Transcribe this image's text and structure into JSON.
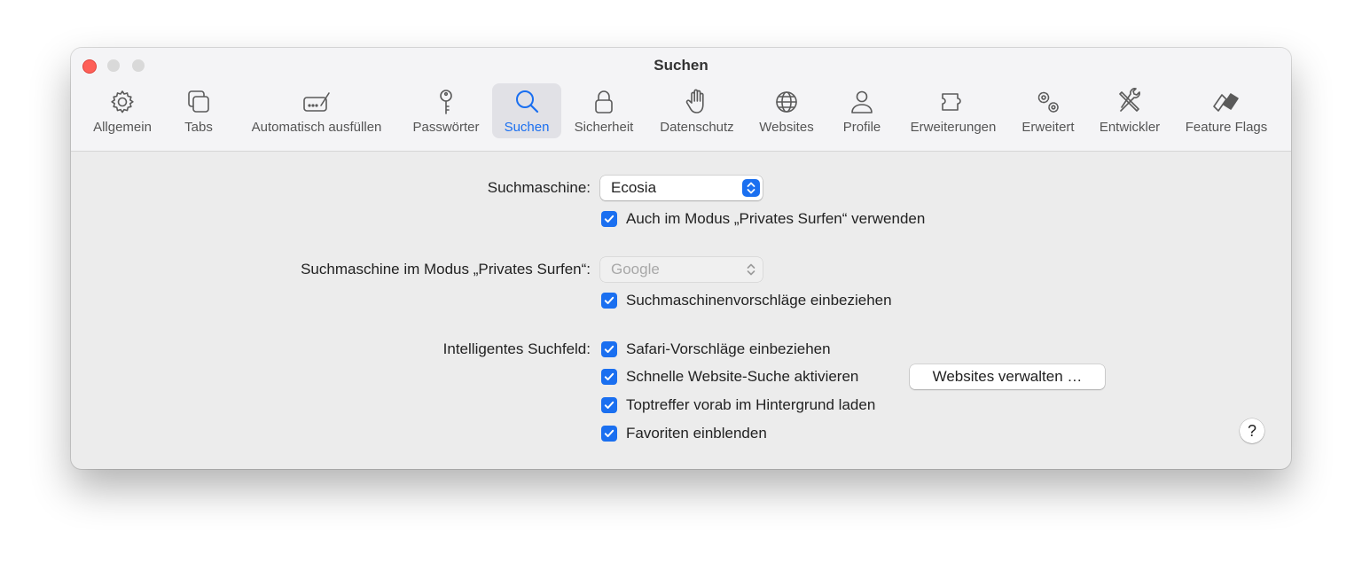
{
  "window": {
    "title": "Suchen"
  },
  "toolbar": {
    "tabs": [
      {
        "label": "Allgemein",
        "icon": "gear-icon"
      },
      {
        "label": "Tabs",
        "icon": "tabs-icon"
      },
      {
        "label": "Automatisch ausfüllen",
        "icon": "autofill-icon"
      },
      {
        "label": "Passwörter",
        "icon": "key-icon"
      },
      {
        "label": "Suchen",
        "icon": "search-icon",
        "active": true
      },
      {
        "label": "Sicherheit",
        "icon": "lock-icon"
      },
      {
        "label": "Datenschutz",
        "icon": "hand-icon"
      },
      {
        "label": "Websites",
        "icon": "globe-icon"
      },
      {
        "label": "Profile",
        "icon": "person-icon"
      },
      {
        "label": "Erweiterungen",
        "icon": "puzzle-icon"
      },
      {
        "label": "Erweitert",
        "icon": "gears-icon"
      },
      {
        "label": "Entwickler",
        "icon": "tools-icon"
      },
      {
        "label": "Feature Flags",
        "icon": "flags-icon"
      }
    ]
  },
  "search_engine": {
    "label": "Suchmaschine:",
    "value": "Ecosia",
    "private_checkbox": {
      "label": "Auch im Modus „Privates Surfen“ verwenden",
      "checked": true
    }
  },
  "private_search_engine": {
    "label": "Suchmaschine im Modus „Privates Surfen“:",
    "value": "Google",
    "disabled": true,
    "suggestions_checkbox": {
      "label": "Suchmaschinenvorschläge einbeziehen",
      "checked": true
    }
  },
  "smart_field": {
    "label": "Intelligentes Suchfeld:",
    "options": [
      {
        "label": "Safari-Vorschläge einbeziehen",
        "checked": true
      },
      {
        "label": "Schnelle Website-Suche aktivieren",
        "checked": true
      },
      {
        "label": "Toptreffer vorab im Hintergrund laden",
        "checked": true
      },
      {
        "label": "Favoriten einblenden",
        "checked": true
      }
    ],
    "manage_button": "Websites verwalten …"
  },
  "help": {
    "label": "?"
  },
  "colors": {
    "accent": "#1a6ff0",
    "close": "#fe5f57"
  }
}
